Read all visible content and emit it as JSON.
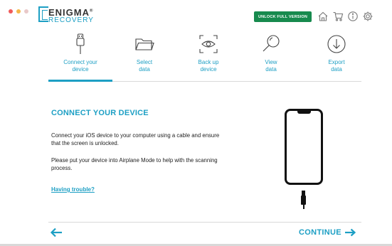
{
  "app": {
    "logo_name": "ENIGMA",
    "logo_mark": "®",
    "logo_subtitle": "RECOVERY"
  },
  "header": {
    "unlock_label": "UNLOCK FULL VERSION",
    "icons": [
      "home-icon",
      "cart-icon",
      "info-icon",
      "gear-icon"
    ]
  },
  "steps": [
    {
      "line1": "Connect your",
      "line2": "device",
      "icon": "usb-cable-icon",
      "active": true
    },
    {
      "line1": "Select",
      "line2": "data",
      "icon": "folder-icon",
      "active": false
    },
    {
      "line1": "Back up",
      "line2": "device",
      "icon": "eye-scan-icon",
      "active": false
    },
    {
      "line1": "View",
      "line2": "data",
      "icon": "magnifier-icon",
      "active": false
    },
    {
      "line1": "Export",
      "line2": "data",
      "icon": "download-icon",
      "active": false
    }
  ],
  "content": {
    "heading": "CONNECT YOUR DEVICE",
    "para1": "Connect your iOS device to your computer using a cable and ensure that the screen is unlocked.",
    "para2": "Please put your device into Airplane Mode to help with the scanning process.",
    "trouble_link": "Having trouble?"
  },
  "footer": {
    "continue_label": "CONTINUE"
  },
  "colors": {
    "accent": "#1d9fc4",
    "unlock_green": "#178a4e"
  }
}
